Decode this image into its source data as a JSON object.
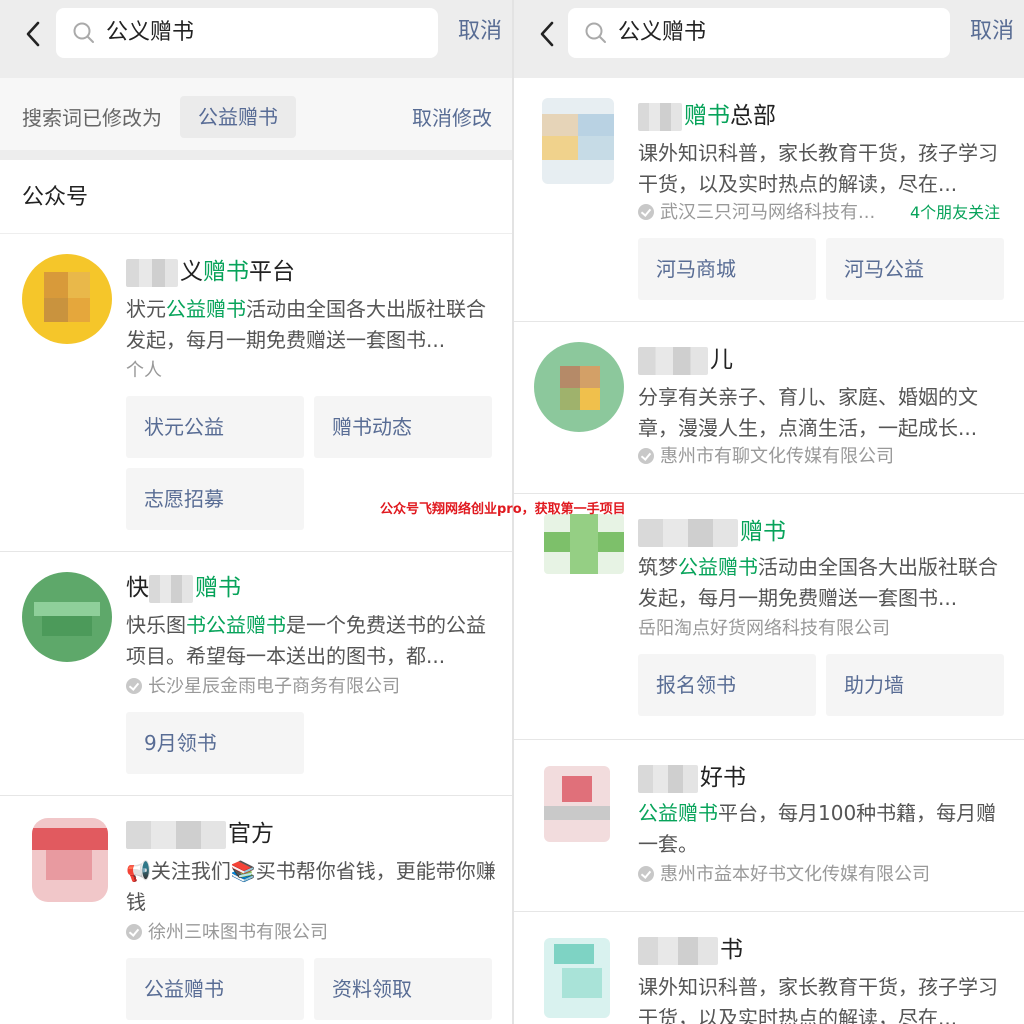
{
  "watermark": "公众号飞翔网络创业pro，获取第一手项目",
  "left": {
    "search": {
      "query": "公义赠书",
      "cancel": "取消"
    },
    "modify": {
      "label": "搜索词已修改为",
      "term": "公益赠书",
      "undo": "取消修改"
    },
    "section_title": "公众号",
    "cards": [
      {
        "title_hl": "赠书",
        "title_tail": "平台",
        "title_head": "义",
        "desc_parts": [
          "状元",
          "公益赠书",
          "活动由全国各大出版社联合发起，每月一期免费赠送一套图书..."
        ],
        "meta": "个人",
        "menu": [
          "状元公益",
          "赠书动态",
          "志愿招募"
        ]
      },
      {
        "title_head": "快",
        "title_hl": "赠书",
        "title_tail": "",
        "desc_parts": [
          "快乐图",
          "书",
          "公益赠书",
          "是一个免费送书的公益项目。希望每一本送出的图书，都..."
        ],
        "meta": "长沙星辰金雨电子商务有限公司",
        "menu": [
          "9月领书"
        ]
      },
      {
        "title_tail": "官方",
        "desc": "📢关注我们📚买书帮你省钱，更能带你赚钱",
        "meta": "徐州三味图书有限公司",
        "menu": [
          "公益赠书",
          "资料领取"
        ]
      }
    ]
  },
  "right": {
    "search": {
      "query": "公义赠书",
      "cancel": "取消"
    },
    "cards": [
      {
        "title_hl": "赠书",
        "title_tail": "总部",
        "desc": "课外知识科普，家长教育干货，孩子学习干货，以及实时热点的解读，尽在...",
        "meta": "武汉三只河马网络科技有...",
        "friends": "4个朋友关注",
        "menu": [
          "河马商城",
          "河马公益"
        ]
      },
      {
        "title_tail": "儿",
        "desc": "分享有关亲子、育儿、家庭、婚姻的文章，漫漫人生，点滴生活，一起成长...",
        "meta": "惠州市有聊文化传媒有限公司"
      },
      {
        "title_hl": "赠书",
        "desc_parts": [
          "筑梦",
          "公益赠书",
          "活动由全国各大出版社联合发起，每月一期免费赠送一套图书..."
        ],
        "meta": "岳阳淘点好货网络科技有限公司",
        "menu": [
          "报名领书",
          "助力墙"
        ]
      },
      {
        "title_tail": "好书",
        "desc_parts": [
          "公益赠书",
          "平台，每月100种书籍，每月赠一套。"
        ],
        "meta": "惠州市益本好书文化传媒有限公司"
      },
      {
        "title_tail": "书",
        "desc": "课外知识科普，家长教育干货，孩子学习干货，以及实时热点的解读，尽在..."
      }
    ]
  },
  "colors": {
    "accent_green": "#07a35a",
    "link_blue": "#586c94",
    "bg": "#ededed"
  }
}
